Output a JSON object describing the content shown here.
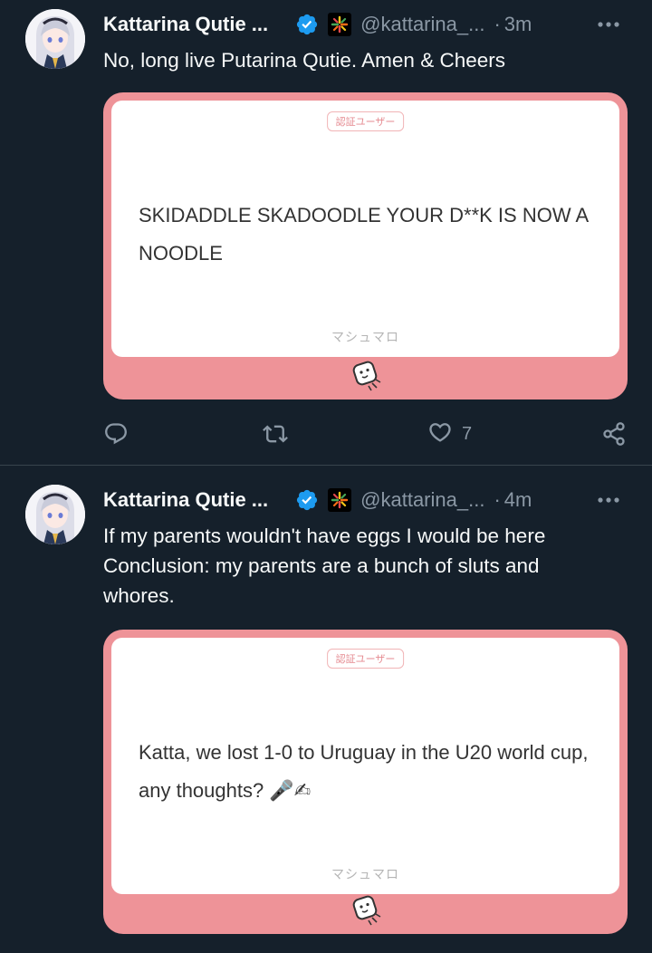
{
  "tweets": [
    {
      "author": "Kattarina Qutie ...",
      "handle": "@kattarina_...",
      "separator": "·",
      "time": "3m",
      "text": "No, long live Putarina Qutie. Amen & Cheers",
      "card": {
        "tag": "認証ユーザー",
        "question": "SKIDADDLE SKADOODLE YOUR D**K IS NOW A NOODLE",
        "site_label": "マシュマロ"
      },
      "likes": "7"
    },
    {
      "author": "Kattarina Qutie ...",
      "handle": "@kattarina_...",
      "separator": "·",
      "time": "4m",
      "text_lines": [
        "If my parents wouldn't have eggs I would be here",
        "Conclusion: my parents are a bunch of sluts and",
        "whores."
      ],
      "card": {
        "tag": "認証ユーザー",
        "question": "Katta, we lost 1-0 to Uruguay in the U20 world cup, any thoughts? 🎤✍",
        "site_label": "マシュマロ"
      }
    }
  ],
  "icons": {
    "more": "more-horizontal-icon",
    "reply": "reply-icon",
    "retweet": "retweet-icon",
    "like": "heart-icon",
    "share": "share-icon",
    "verified": "verified-badge-icon",
    "affiliate": "affiliate-badge-icon"
  },
  "colors": {
    "background": "#15202b",
    "secondary_text": "#8b98a5",
    "verified_blue": "#1d9bf0",
    "card_pink": "#ee9398"
  }
}
